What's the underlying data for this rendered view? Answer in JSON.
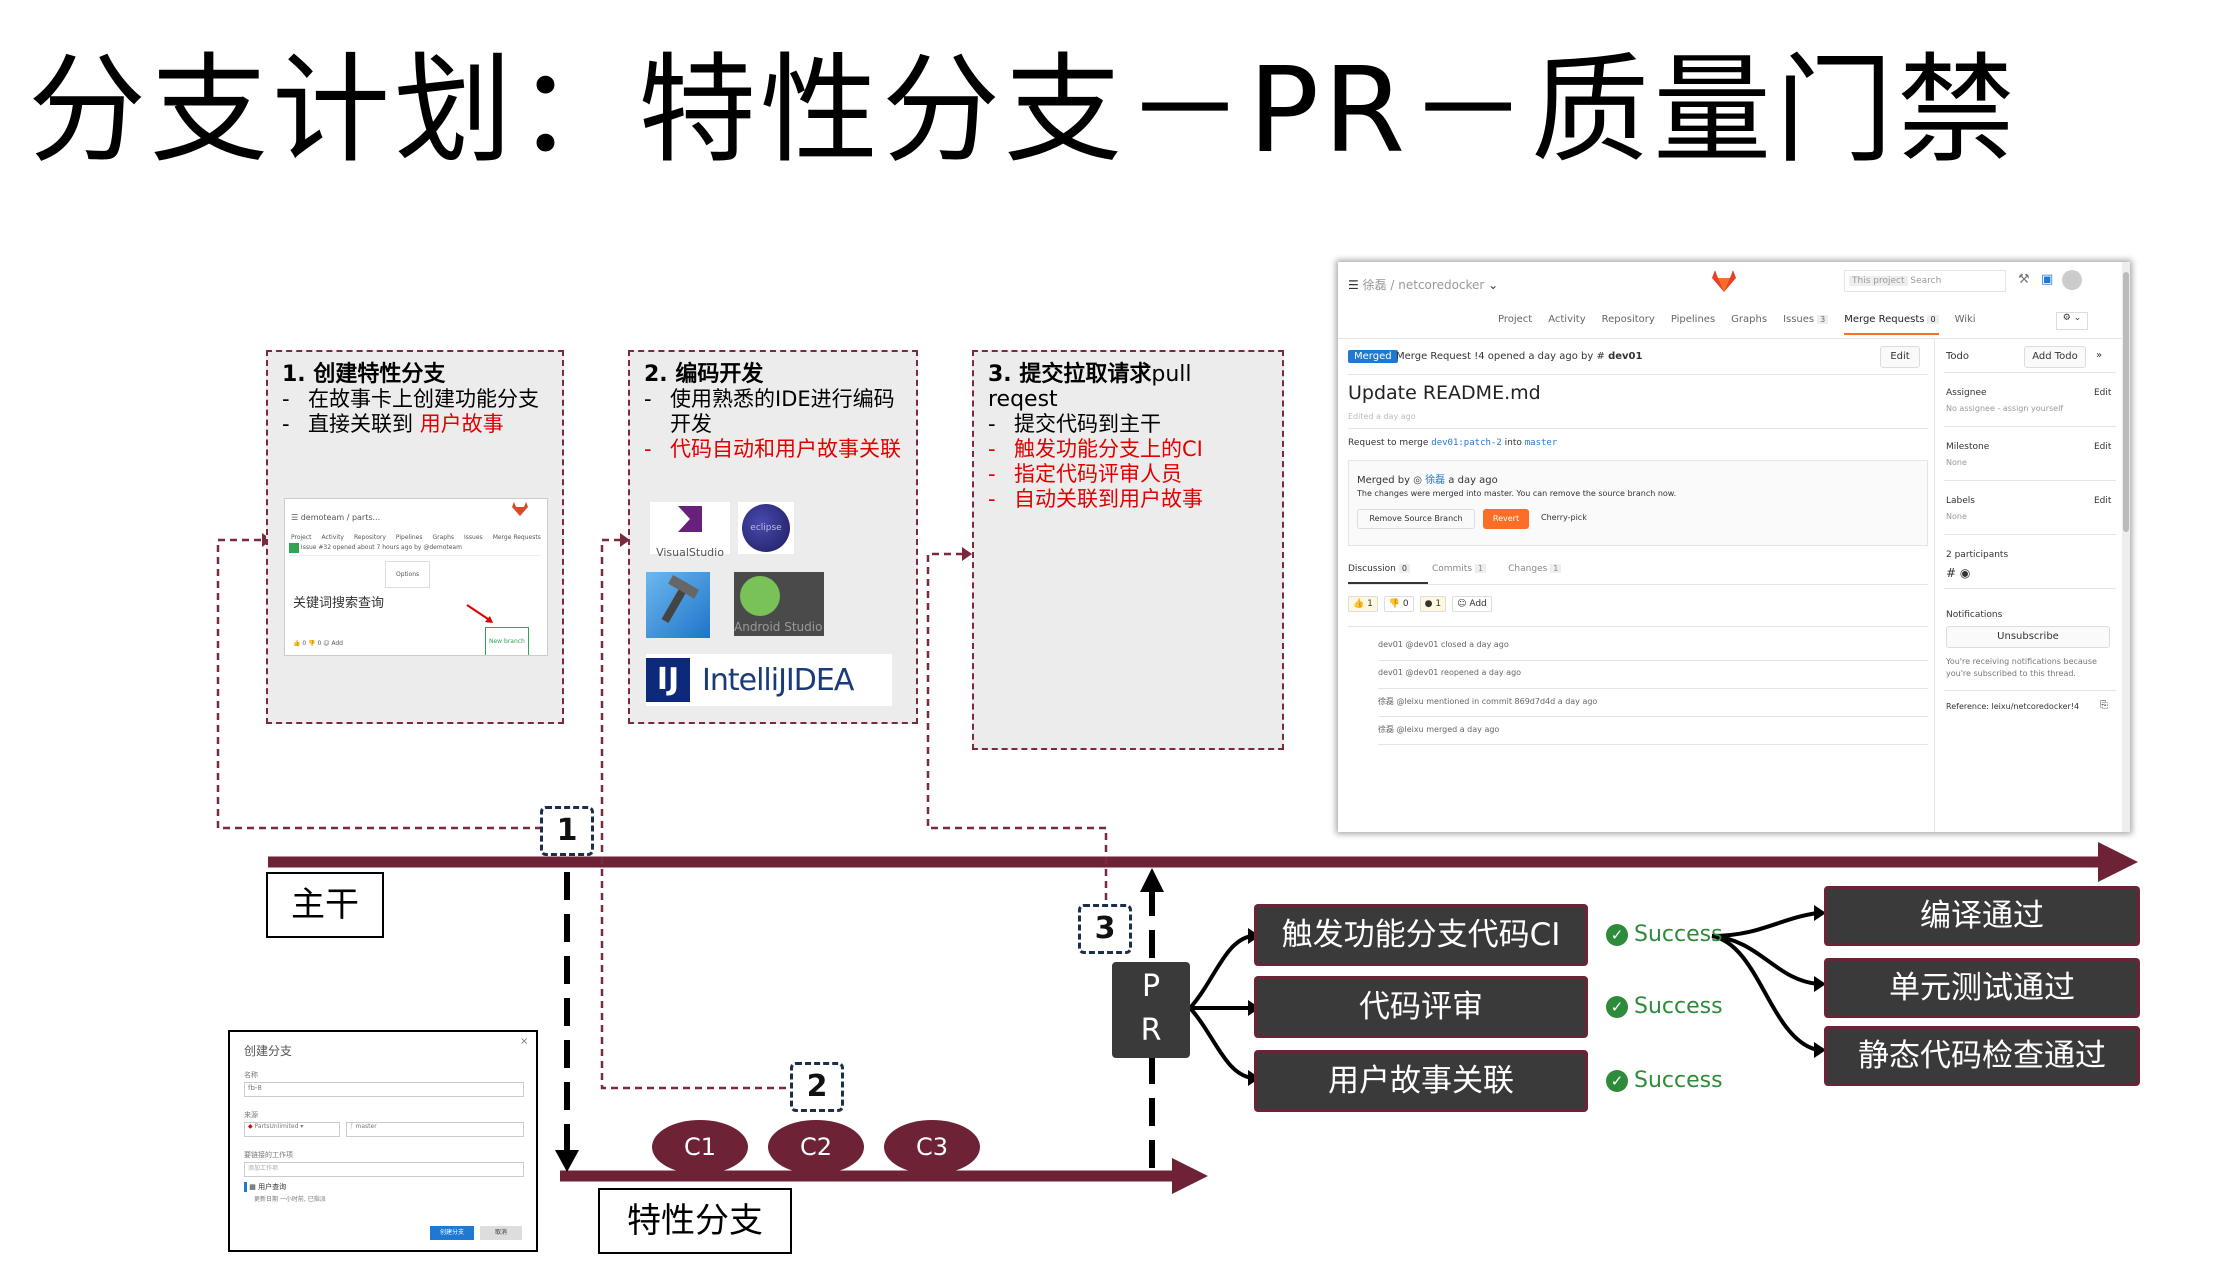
{
  "title": "分支计划：特性分支－PR－质量门禁",
  "steps": [
    {
      "title_num": "1.",
      "title": "创建特性分支",
      "title_rest": "",
      "lines": [
        {
          "text": "在故事卡上创建功能分支",
          "red": false
        },
        {
          "text_a": "直接关联到 ",
          "text_b": "用户故事",
          "red": false
        }
      ]
    },
    {
      "title_num": "2.",
      "title": "编码开发",
      "title_rest": "",
      "lines": [
        {
          "text": "使用熟悉的IDE进行编码开发",
          "red": false
        },
        {
          "text": "代码自动和用户故事关联",
          "red": true
        }
      ]
    },
    {
      "title_num": "3.",
      "title": "提交拉取请求",
      "title_rest": "pull reqest",
      "lines": [
        {
          "text": "提交代码到主干",
          "red": false
        },
        {
          "text": "触发功能分支上的CI",
          "red": true
        },
        {
          "text": "指定代码评审人员",
          "red": true
        },
        {
          "text": "自动关联到用户故事",
          "red": true
        }
      ]
    }
  ],
  "step1_mini": {
    "project": "demoteam / parts...",
    "tabs": [
      "Project",
      "Activity",
      "Repository",
      "Pipelines",
      "Graphs",
      "Issues",
      "Merge Requests"
    ],
    "issue": "Issue #32 opened about 7 hours ago by @demoteam",
    "options": "Options",
    "heading": "关键词搜索查询",
    "new_branch": "New branch",
    "add": "Add"
  },
  "ide_logos": {
    "vs": "VisualStudio",
    "eclipse": "eclipse",
    "android": "Android Studio",
    "intellij_mark": "IJ",
    "intellij": "IntelliJIDEA"
  },
  "labels": {
    "trunk": "主干",
    "feature": "特性分支",
    "pr": [
      "P",
      "R"
    ]
  },
  "badges": [
    "1",
    "2",
    "3"
  ],
  "commits": [
    "C1",
    "C2",
    "C3"
  ],
  "checks": [
    "触发功能分支代码CI",
    "代码评审",
    "用户故事关联"
  ],
  "success": "Success",
  "results": [
    "编译通过",
    "单元测试通过",
    "静态代码检查通过"
  ],
  "dialog": {
    "title": "创建分支",
    "name_label": "名称",
    "name_value": "fb-8",
    "source_label": "来源",
    "source_repo": "PartsUnlimited",
    "source_branch": "master",
    "work_label": "要链接的工作项",
    "work_placeholder": "添加工作项",
    "story": "用户查询",
    "story_sub": "更新日期 一小时前, 已指派",
    "create": "创建分支",
    "cancel": "取消"
  },
  "gitlab": {
    "breadcrumb": "徐磊 / netcoredocker",
    "search_scope": "This project",
    "search": "Search",
    "nav": [
      "Project",
      "Activity",
      "Repository",
      "Pipelines",
      "Graphs",
      "Issues",
      "Merge Requests",
      "Wiki"
    ],
    "issues_count": "3",
    "mr_count": "0",
    "status": "Merged",
    "mr_line": "Merge Request !4 opened a day ago by",
    "author": "dev01",
    "edit": "Edit",
    "mr_title": "Update README.md",
    "edited": "Edited a day ago",
    "request_prefix": "Request to merge",
    "source_branch": "dev01:patch-2",
    "into": "into",
    "target_branch": "master",
    "merged_by": "Merged by",
    "merged_user": "徐磊",
    "merged_when": "a day ago",
    "merged_msg": "The changes were merged into master. You can remove the source branch now.",
    "remove_btn": "Remove Source Branch",
    "revert_btn": "Revert",
    "cherry": "Cherry-pick",
    "tabs": [
      "Discussion",
      "Commits",
      "Changes"
    ],
    "tab_counts": [
      "0",
      "1",
      "1"
    ],
    "emoji": [
      "1",
      "0",
      "1"
    ],
    "emoji_add": "Add",
    "events": [
      "dev01 @dev01 closed a day ago",
      "dev01 @dev01 reopened a day ago",
      "徐磊 @leixu mentioned in commit 869d7d4d a day ago",
      "徐磊 @leixu merged a day ago"
    ],
    "side": {
      "todo": "Todo",
      "add_todo": "Add Todo",
      "assignee": "Assignee",
      "no_assignee": "No assignee - assign yourself",
      "milestone": "Milestone",
      "none": "None",
      "labels": "Labels",
      "participants": "2 participants",
      "notifications": "Notifications",
      "unsubscribe": "Unsubscribe",
      "notif_msg": "You're receiving notifications because you're subscribed to this thread.",
      "reference": "Reference: leixu/netcoredocker!4",
      "edit": "Edit"
    }
  },
  "colors": {
    "branch": "#6e2236",
    "dark": "#3a3a3a",
    "success": "#2e8b3a",
    "red": "#e00000",
    "dashed_border": "#7a2a3a"
  }
}
